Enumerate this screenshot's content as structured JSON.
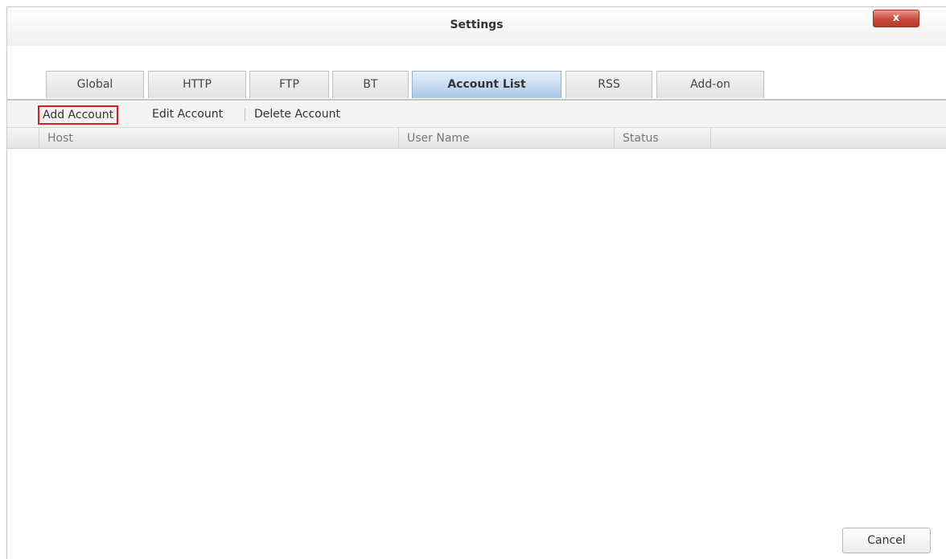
{
  "window": {
    "title": "Settings",
    "close_label": "x"
  },
  "tabs": [
    {
      "label": "Global",
      "active": false
    },
    {
      "label": "HTTP",
      "active": false
    },
    {
      "label": "FTP",
      "active": false
    },
    {
      "label": "BT",
      "active": false
    },
    {
      "label": "Account List",
      "active": true
    },
    {
      "label": "RSS",
      "active": false
    },
    {
      "label": "Add-on",
      "active": false
    }
  ],
  "toolbar": {
    "add_label": "Add Account",
    "edit_label": "Edit Account",
    "delete_label": "Delete Account"
  },
  "grid": {
    "columns": [
      "Host",
      "User Name",
      "Status"
    ],
    "rows": []
  },
  "footer": {
    "cancel_label": "Cancel"
  },
  "colors": {
    "highlight": "#e01b1b",
    "active_tab": "#a9c8e8",
    "close_button": "#c9493a"
  }
}
